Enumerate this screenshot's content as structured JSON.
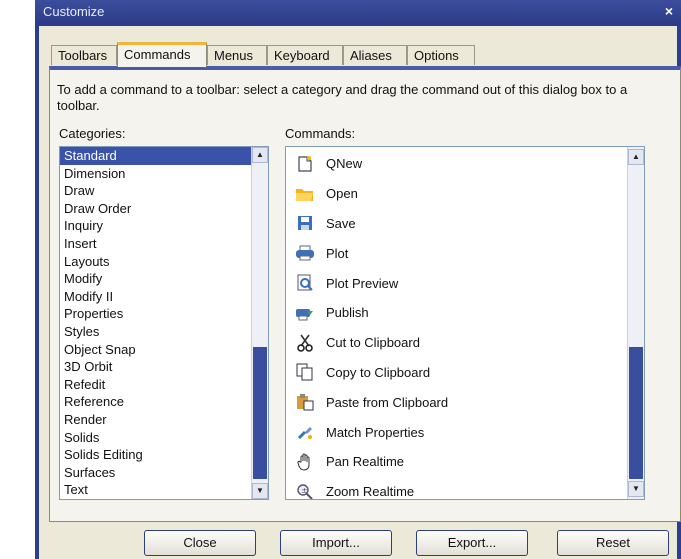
{
  "window": {
    "title": "Customize",
    "close_glyph": "×"
  },
  "tabs": [
    "Toolbars",
    "Commands",
    "Menus",
    "Keyboard",
    "Aliases",
    "Options"
  ],
  "active_tab": "Commands",
  "instructions": "To add a command to a toolbar: select a category and drag the command out of this dialog box to a toolbar.",
  "categories_label": "Categories:",
  "commands_label": "Commands:",
  "categories": [
    "Standard",
    "Dimension",
    "Draw",
    "Draw Order",
    "Inquiry",
    "Insert",
    "Layouts",
    "Modify",
    "Modify II",
    "Properties",
    "Styles",
    "Object Snap",
    "3D Orbit",
    "Refedit",
    "Reference",
    "Render",
    "Solids",
    "Solids Editing",
    "Surfaces",
    "Text"
  ],
  "selected_category": "Standard",
  "commands": [
    {
      "label": "QNew",
      "icon": "new-document-icon"
    },
    {
      "label": "Open",
      "icon": "folder-open-icon"
    },
    {
      "label": "Save",
      "icon": "floppy-disk-icon"
    },
    {
      "label": "Plot",
      "icon": "printer-icon"
    },
    {
      "label": "Plot Preview",
      "icon": "plot-preview-icon"
    },
    {
      "label": "Publish",
      "icon": "publish-icon"
    },
    {
      "label": "Cut to Clipboard",
      "icon": "scissors-icon"
    },
    {
      "label": "Copy to Clipboard",
      "icon": "copy-icon"
    },
    {
      "label": "Paste from Clipboard",
      "icon": "paste-icon"
    },
    {
      "label": "Match Properties",
      "icon": "match-properties-brush-icon"
    },
    {
      "label": "Pan Realtime",
      "icon": "hand-pan-icon"
    },
    {
      "label": "Zoom Realtime",
      "icon": "zoom-realtime-icon"
    }
  ],
  "buttons": {
    "close": "Close",
    "import": "Import...",
    "export": "Export...",
    "reset": "Reset"
  },
  "colors": {
    "title_bar": "#2b3b87",
    "selection": "#3a52a8",
    "tab_accent": "#f0b53c",
    "scroll_thumb": "#3a4ea0"
  }
}
